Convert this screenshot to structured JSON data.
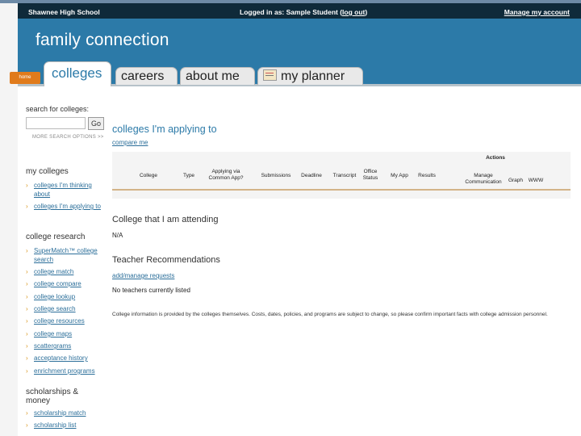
{
  "topbar": {
    "school": "Shawnee High School",
    "logged_in_prefix": "Logged in as: Sample Student (",
    "logout": "log out",
    "logged_in_suffix": ")",
    "manage": "Manage my account"
  },
  "header": {
    "brand": "family connection",
    "home_tab": "home",
    "tabs": [
      "colleges",
      "careers",
      "about me",
      "my planner"
    ]
  },
  "sidebar": {
    "search_label": "search for colleges:",
    "search_value": "",
    "go_label": "Go",
    "more_link": "MORE SEARCH OPTIONS >>",
    "my_colleges_title": "my colleges",
    "my_colleges": [
      "colleges I'm thinking about",
      "colleges I'm applying to"
    ],
    "research_title": "college research",
    "research": [
      "SuperMatch™ college search",
      "college match",
      "college compare",
      "college lookup",
      "college search",
      "college resources",
      "college maps",
      "scattergrams",
      "acceptance history",
      "enrichment programs"
    ],
    "scholarships_title": "scholarships & money",
    "scholarships": [
      "scholarship match",
      "scholarship list"
    ]
  },
  "main": {
    "applying_title": "colleges I'm applying to",
    "compare_link": "compare me",
    "table": {
      "actions_label": "Actions",
      "headers": [
        "College",
        "Type",
        "Applying via Common App?",
        "Submissions",
        "Deadline",
        "Transcript",
        "Office Status",
        "My App",
        "Results",
        "Manage Communication",
        "Graph",
        "WWW"
      ]
    },
    "attending_title": "College that I am attending",
    "attending_value": "N/A",
    "teacher_title": "Teacher Recommendations",
    "add_manage": "add/manage requests",
    "no_teachers": "No teachers currently listed",
    "disclaimer": "College information is provided by the colleges themselves. Costs, dates, policies, and programs are subject to change, so please confirm important facts with college admission personnel."
  },
  "colors": {
    "header_blue": "#2c7aa8",
    "topbar": "#0f2a3a",
    "home_orange": "#e07b1c",
    "link_blue": "#2c6f9a",
    "bullet_orange": "#d9971e"
  }
}
